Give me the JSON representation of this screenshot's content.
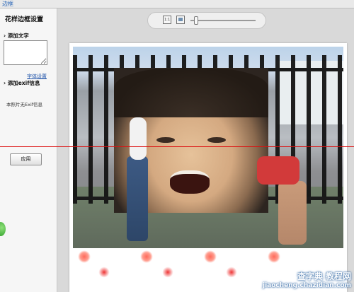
{
  "window": {
    "title": "边框"
  },
  "sidebar": {
    "title": "花样边框设置",
    "add_text_label": "添加文字",
    "text_value": "",
    "font_settings_link": "字体设置",
    "add_exif_label": "添加exif信息",
    "exif_note": "本照片无Exif信息",
    "apply_button": "应用"
  },
  "toolbar": {
    "actual_size_icon": "1:1",
    "fit_icon": "fit-window-icon",
    "zoom_level": 0.05
  },
  "watermark": {
    "line1": "查字典 教程网",
    "line2": "jiaocheng.chazidian.com"
  }
}
